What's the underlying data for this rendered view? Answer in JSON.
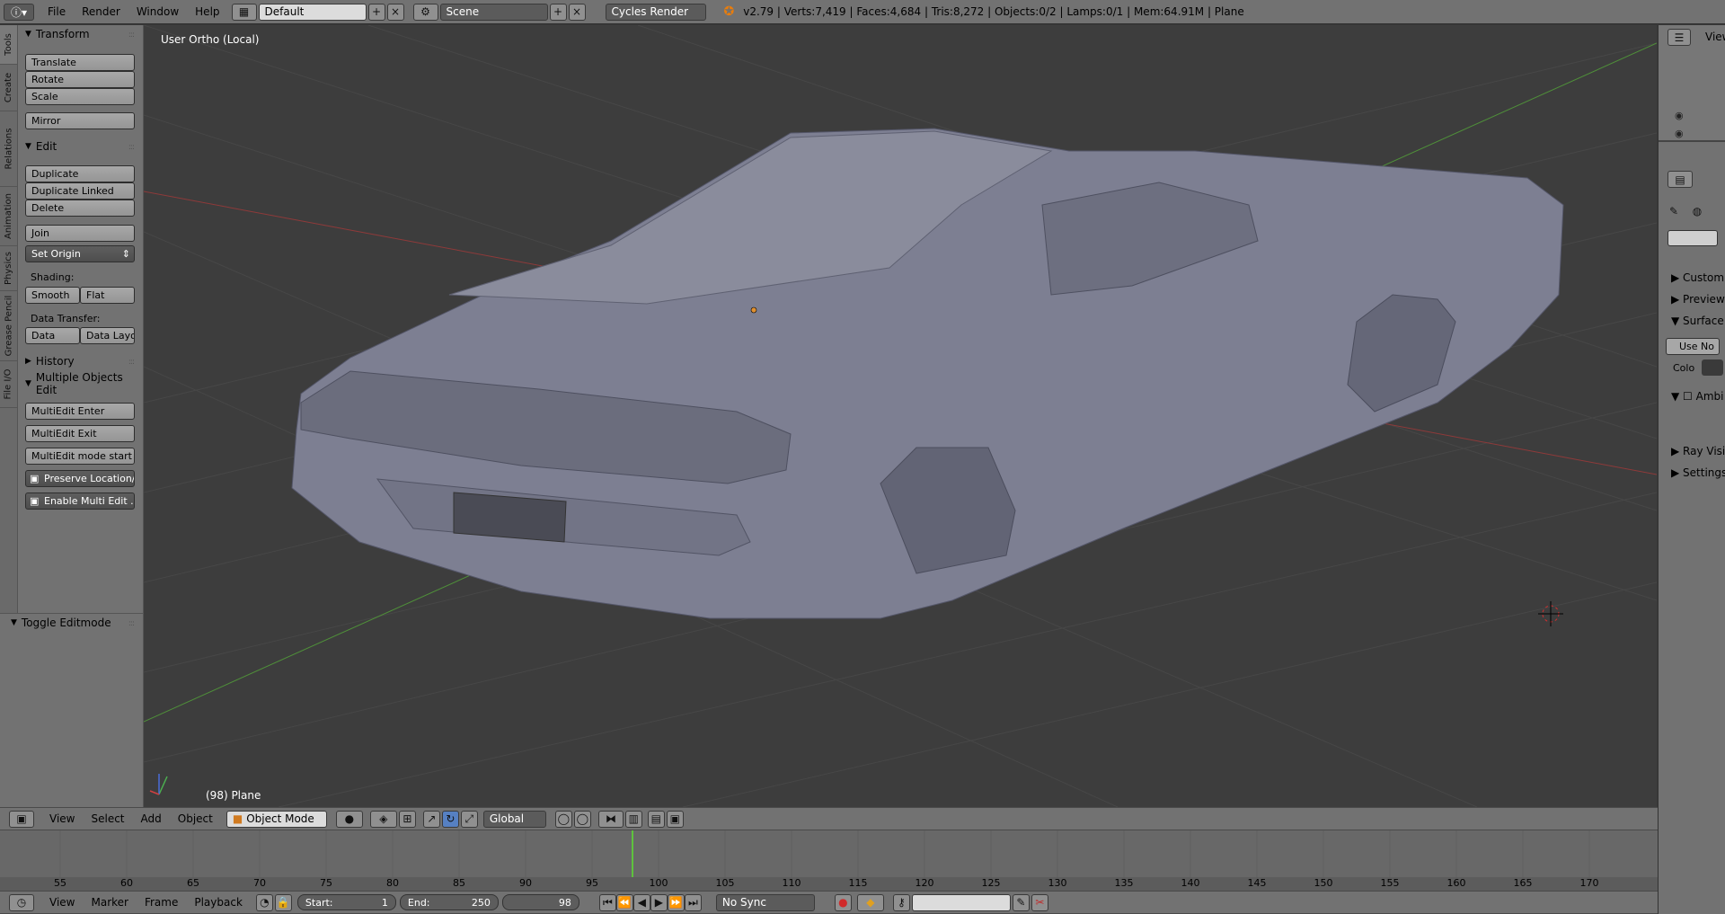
{
  "topbar": {
    "menus": [
      "File",
      "Render",
      "Window",
      "Help"
    ],
    "layout": "Default",
    "scene": "Scene",
    "engine": "Cycles Render",
    "stats": "v2.79 | Verts:7,419 | Faces:4,684 | Tris:8,272 | Objects:0/2 | Lamps:0/1 | Mem:64.91M | Plane"
  },
  "toolshelf": {
    "tabs": [
      "Tools",
      "Create",
      "Relations",
      "Animation",
      "Physics",
      "Grease Pencil",
      "File I/O"
    ],
    "transform": {
      "title": "Transform",
      "translate": "Translate",
      "rotate": "Rotate",
      "scale": "Scale",
      "mirror": "Mirror"
    },
    "edit": {
      "title": "Edit",
      "duplicate": "Duplicate",
      "duplicate_linked": "Duplicate Linked",
      "delete": "Delete",
      "join": "Join",
      "set_origin": "Set Origin",
      "shading_label": "Shading:",
      "smooth": "Smooth",
      "flat": "Flat",
      "data_transfer_label": "Data Transfer:",
      "data": "Data",
      "data_layout": "Data Layo"
    },
    "history": {
      "title": "History"
    },
    "multi": {
      "title": "Multiple Objects Edit",
      "enter": "MultiEdit Enter",
      "exit": "MultiEdit Exit",
      "mode_start": "MultiEdit mode start",
      "preserve": "Preserve Location/...",
      "enable": "Enable Multi Edit ..."
    },
    "operator": {
      "title": "Toggle Editmode"
    }
  },
  "viewport": {
    "title": "User Ortho (Local)",
    "object_label": "(98) Plane"
  },
  "rightpanel": {
    "view_label": "View",
    "custom": "Custom",
    "preview": "Preview",
    "surface": "Surface",
    "use_nodes": "Use No",
    "color": "Colo",
    "ambi": "Ambi",
    "ray_visibility": "Ray Visi",
    "settings": "Settings"
  },
  "vpheader": {
    "menus": [
      "View",
      "Select",
      "Add",
      "Object"
    ],
    "mode": "Object Mode",
    "orientation": "Global"
  },
  "timeline": {
    "ticks": [
      "55",
      "60",
      "65",
      "70",
      "75",
      "80",
      "85",
      "90",
      "95",
      "100",
      "105",
      "110",
      "115",
      "120",
      "125",
      "130",
      "135",
      "140",
      "145",
      "150",
      "155",
      "160",
      "165",
      "170"
    ],
    "menus": [
      "View",
      "Marker",
      "Frame",
      "Playback"
    ],
    "start_label": "Start:",
    "start": "1",
    "end_label": "End:",
    "end": "250",
    "current": "98",
    "sync": "No Sync"
  },
  "colors": {
    "background": "#3d3d3d",
    "panel": "#727272",
    "timeline_cursor": "#5ec23e",
    "x_axis": "#c23838",
    "y_axis": "#5ca83a"
  }
}
